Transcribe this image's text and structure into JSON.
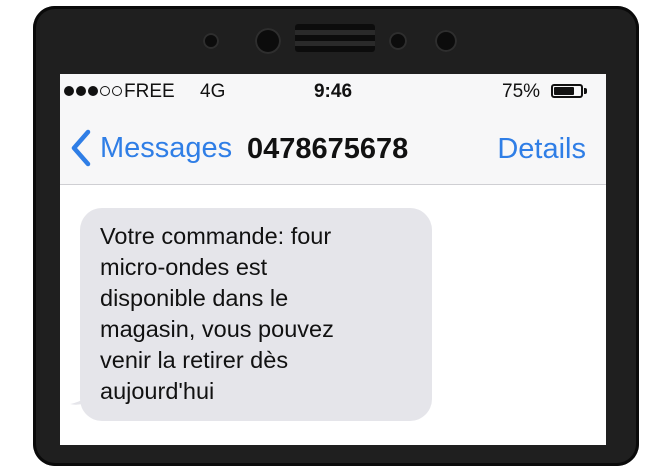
{
  "status_bar": {
    "signal_bars_filled": 3,
    "signal_bars_total": 5,
    "carrier": "FREE",
    "network": "4G",
    "time": "9:46",
    "battery_percent_label": "75%",
    "battery_level": 0.75
  },
  "nav_bar": {
    "back_label": "Messages",
    "title": "0478675678",
    "details_label": "Details"
  },
  "messages": [
    {
      "direction": "incoming",
      "text": "Votre commande: four\nmicro-ondes est\ndisponible dans le\nmagasin, vous pouvez\nvenir la retirer dès\naujourd'hui"
    }
  ],
  "colors": {
    "accent": "#2f7ee6",
    "incoming_bubble": "#e5e5ea",
    "phone_body": "#1f1f1f",
    "bars_background": "#f7f7f8"
  }
}
